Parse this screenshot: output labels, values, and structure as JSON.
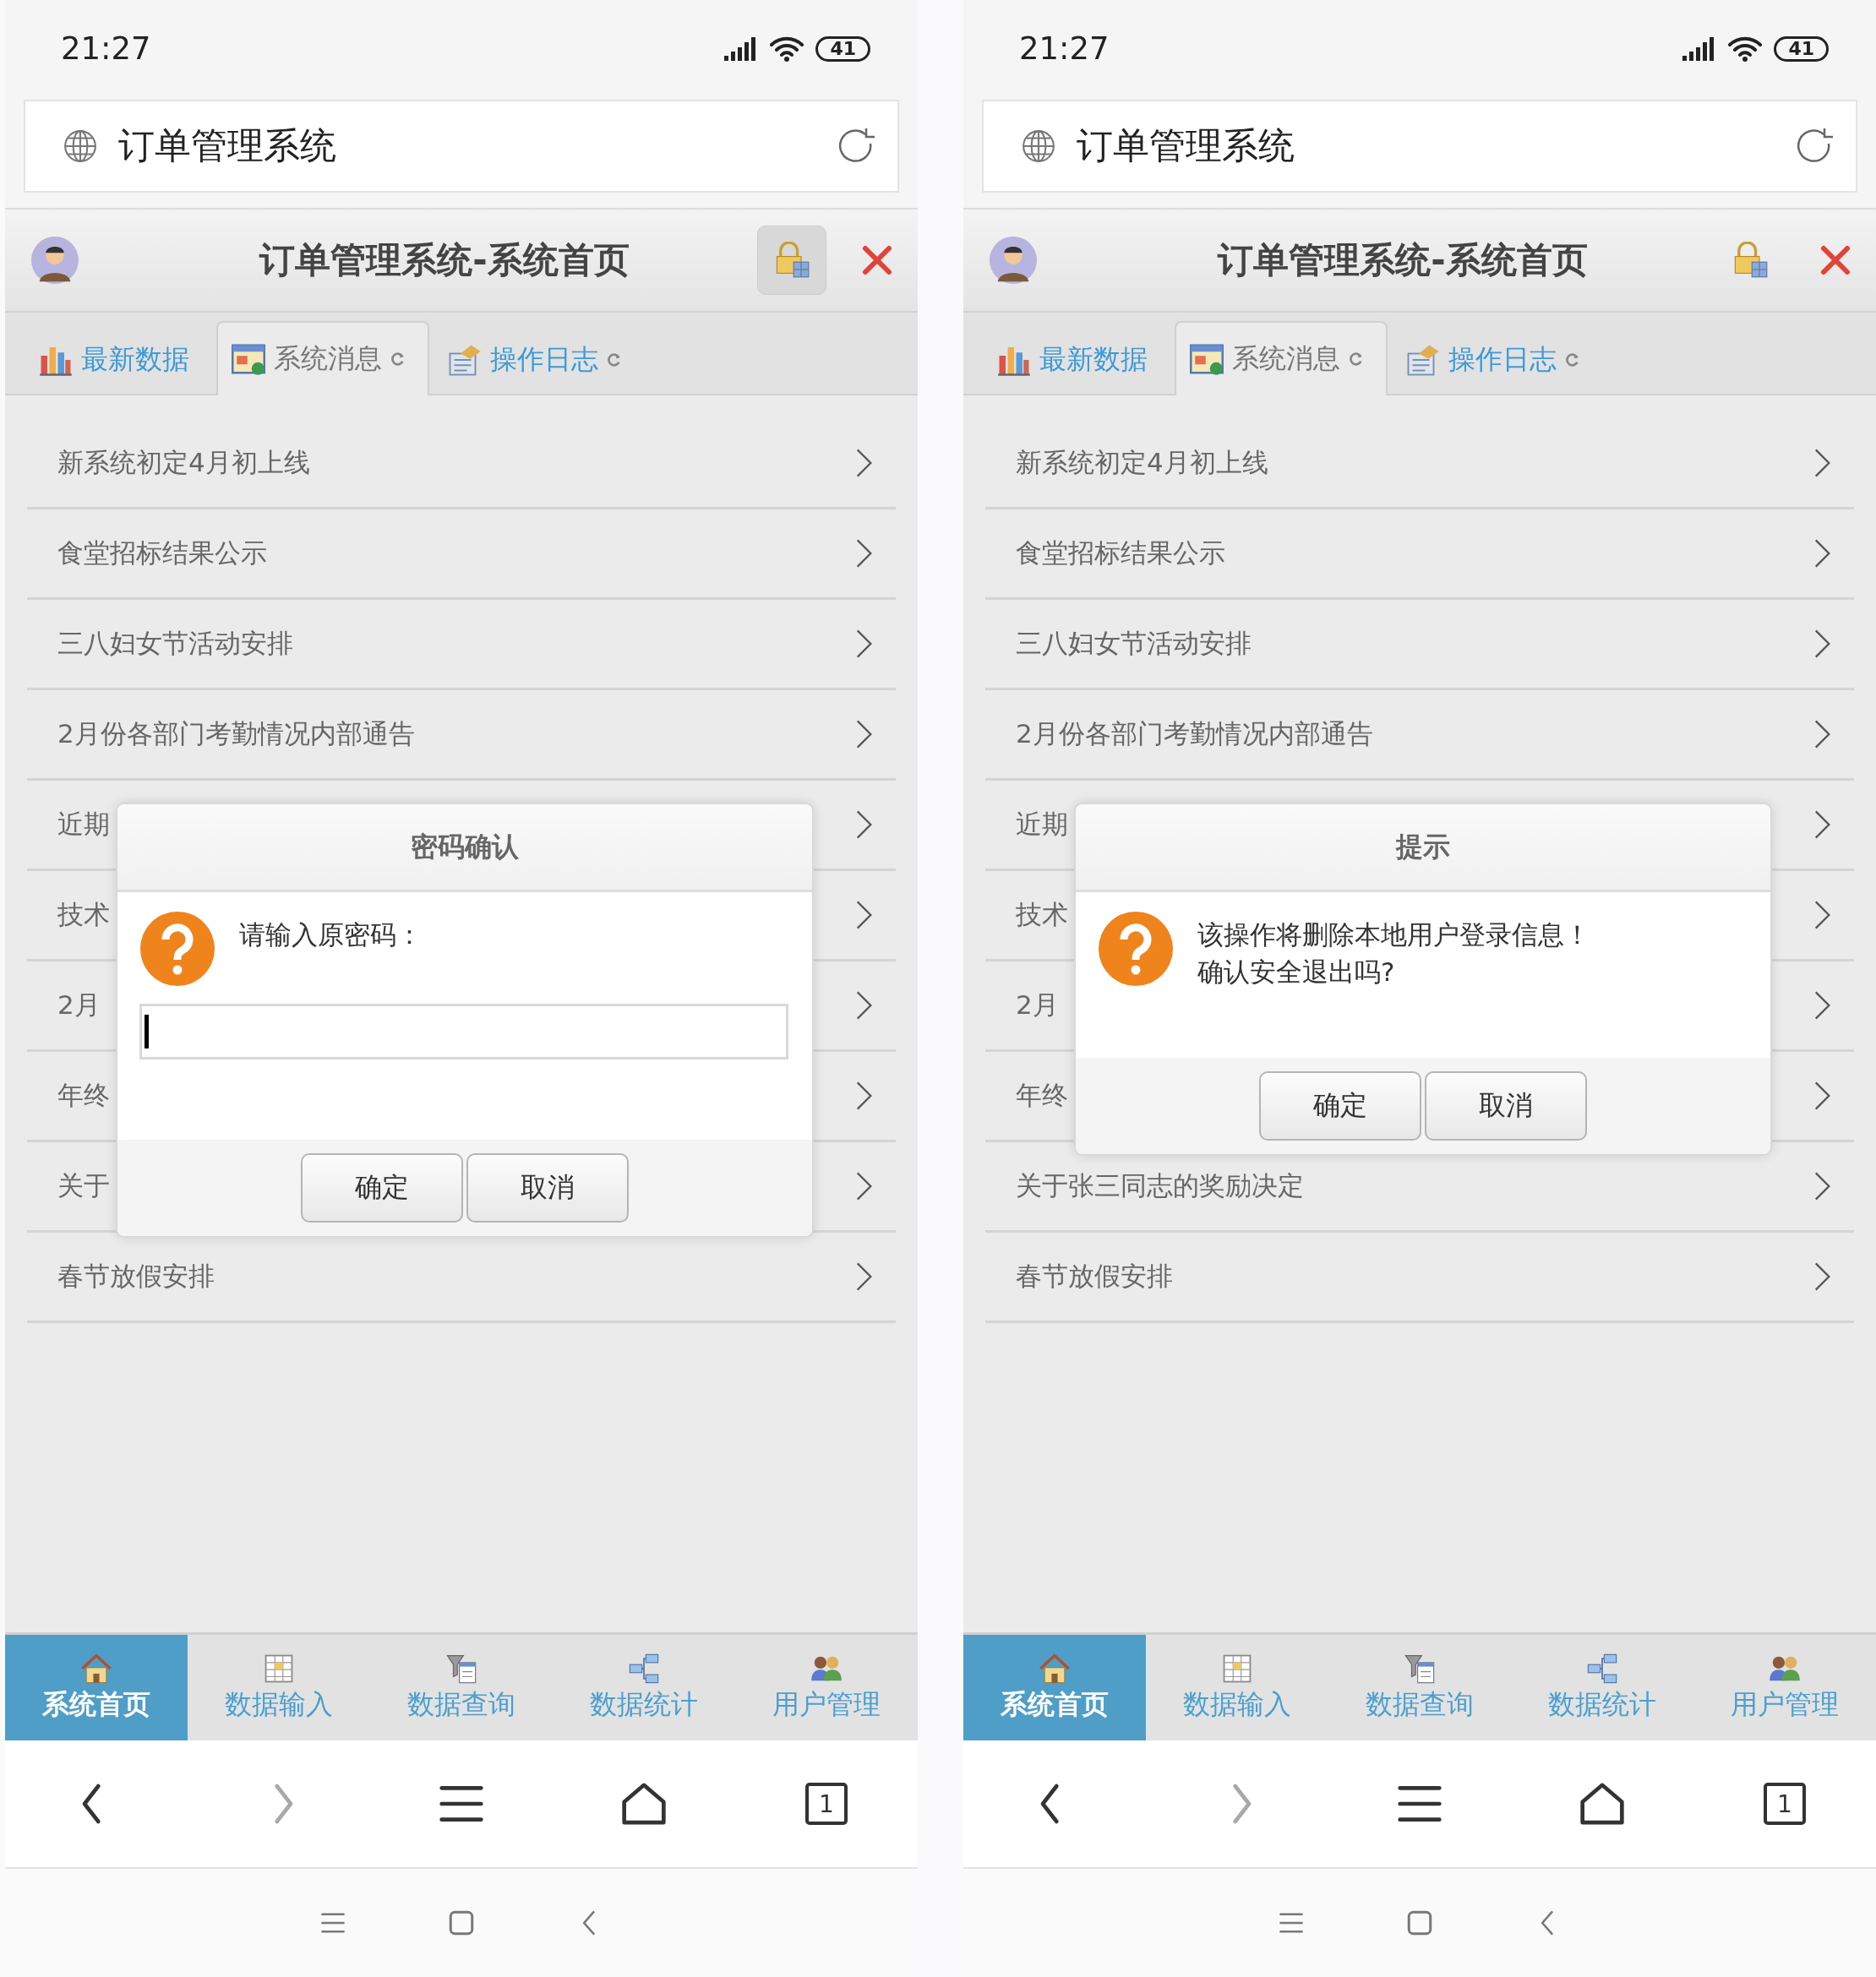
{
  "phones": [
    {
      "status_bar": {
        "time": "21:27",
        "battery": "41"
      },
      "address_bar": {
        "title": "订单管理系统"
      },
      "header": {
        "title": "订单管理系统-系统首页",
        "lock_pressed": true
      },
      "tabs": [
        {
          "label": "最新数据",
          "selected": false,
          "kind": "chart",
          "refresh": false
        },
        {
          "label": "系统消息",
          "selected": true,
          "kind": "window",
          "refresh": true
        },
        {
          "label": "操作日志",
          "selected": false,
          "kind": "log",
          "refresh": true
        }
      ],
      "messages": [
        {
          "text": "新系统初定4月初上线"
        },
        {
          "text": "食堂招标结果公示"
        },
        {
          "text": "三八妇女节活动安排"
        },
        {
          "text": "2月份各部门考勤情况内部通告"
        },
        {
          "text": "近期"
        },
        {
          "text": "技术"
        },
        {
          "text": "2月"
        },
        {
          "text": "年终"
        },
        {
          "text": "关于"
        },
        {
          "text": "春节放假安排"
        }
      ],
      "dialog": {
        "kind": "password",
        "title": "密码确认",
        "message": [
          "请输入原密码："
        ],
        "password_field": {
          "focused": true
        },
        "buttons": [
          "确定",
          "取消"
        ]
      },
      "bottom_nav": [
        {
          "label": "系统首页",
          "selected": true,
          "kind": "home"
        },
        {
          "label": "数据输入",
          "selected": false,
          "kind": "grid"
        },
        {
          "label": "数据查询",
          "selected": false,
          "kind": "filter"
        },
        {
          "label": "数据统计",
          "selected": false,
          "kind": "diagram"
        },
        {
          "label": "用户管理",
          "selected": false,
          "kind": "users"
        }
      ],
      "browser_toolbar": [
        {
          "kind": "back",
          "disabled": false
        },
        {
          "kind": "forward",
          "disabled": true
        },
        {
          "kind": "menu",
          "disabled": false
        },
        {
          "kind": "home",
          "disabled": false
        },
        {
          "kind": "tabs",
          "disabled": false,
          "count": "1"
        }
      ]
    },
    {
      "status_bar": {
        "time": "21:27",
        "battery": "41"
      },
      "address_bar": {
        "title": "订单管理系统"
      },
      "header": {
        "title": "订单管理系统-系统首页",
        "lock_pressed": false
      },
      "tabs": [
        {
          "label": "最新数据",
          "selected": false,
          "kind": "chart",
          "refresh": false
        },
        {
          "label": "系统消息",
          "selected": true,
          "kind": "window",
          "refresh": true
        },
        {
          "label": "操作日志",
          "selected": false,
          "kind": "log",
          "refresh": true
        }
      ],
      "messages": [
        {
          "text": "新系统初定4月初上线"
        },
        {
          "text": "食堂招标结果公示"
        },
        {
          "text": "三八妇女节活动安排"
        },
        {
          "text": "2月份各部门考勤情况内部通告"
        },
        {
          "text": "近期"
        },
        {
          "text": "技术"
        },
        {
          "text": "2月"
        },
        {
          "text": "年终"
        },
        {
          "text": "关于张三同志的奖励决定"
        },
        {
          "text": "春节放假安排"
        }
      ],
      "dialog": {
        "kind": "confirm",
        "title": "提示",
        "message": [
          "该操作将删除本地用户登录信息！",
          "确认安全退出吗?"
        ],
        "buttons": [
          "确定",
          "取消"
        ]
      },
      "bottom_nav": [
        {
          "label": "系统首页",
          "selected": true,
          "kind": "home"
        },
        {
          "label": "数据输入",
          "selected": false,
          "kind": "grid"
        },
        {
          "label": "数据查询",
          "selected": false,
          "kind": "filter"
        },
        {
          "label": "数据统计",
          "selected": false,
          "kind": "diagram"
        },
        {
          "label": "用户管理",
          "selected": false,
          "kind": "users"
        }
      ],
      "browser_toolbar": [
        {
          "kind": "back",
          "disabled": false
        },
        {
          "kind": "forward",
          "disabled": true
        },
        {
          "kind": "menu",
          "disabled": false
        },
        {
          "kind": "home",
          "disabled": false
        },
        {
          "kind": "tabs",
          "disabled": false,
          "count": "1"
        }
      ]
    }
  ]
}
